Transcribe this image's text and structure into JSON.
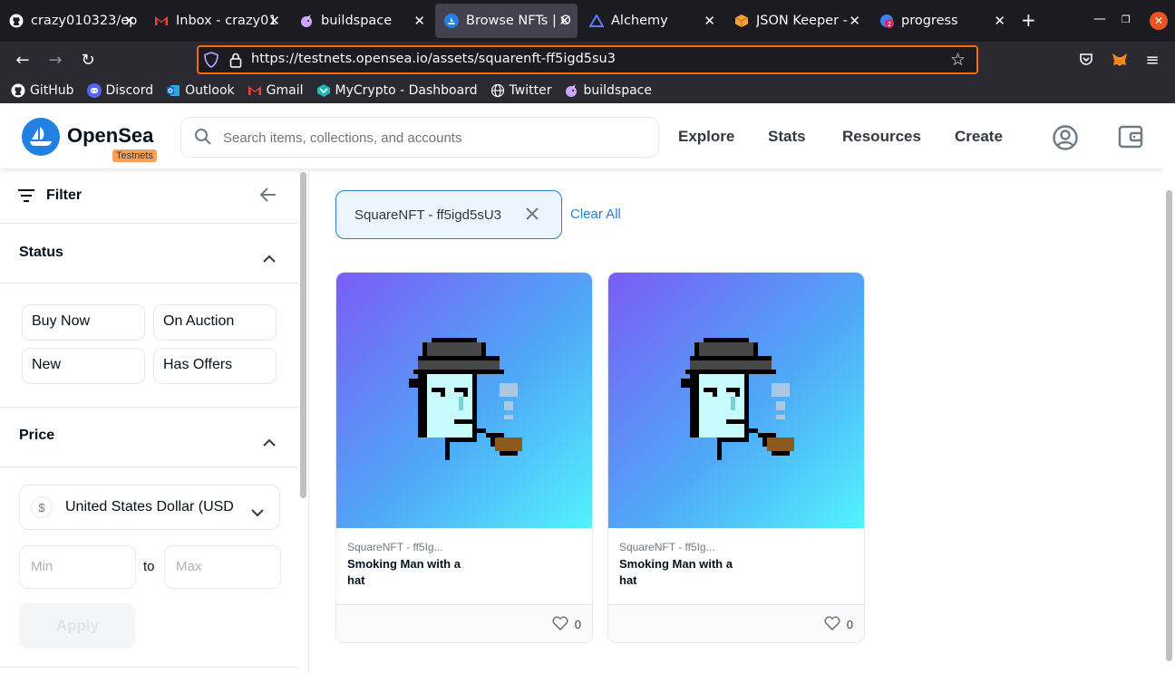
{
  "tabs": [
    {
      "title": "crazy010323/ep",
      "icon": "github-icon"
    },
    {
      "title": "Inbox - crazy01",
      "icon": "gmail-icon"
    },
    {
      "title": "buildspace",
      "icon": "unicorn-icon"
    },
    {
      "title": "Browse NFTs | O",
      "icon": "opensea-icon"
    },
    {
      "title": "Alchemy",
      "icon": "alchemy-icon"
    },
    {
      "title": "JSON Keeper - ",
      "icon": "box-icon"
    },
    {
      "title": "progress",
      "icon": "progress-icon"
    }
  ],
  "address_bar": {
    "url": "https://testnets.opensea.io/assets/squarenft-ff5igd5su3"
  },
  "bookmarks": [
    {
      "label": "GitHub",
      "icon": "github-icon"
    },
    {
      "label": "Discord",
      "icon": "discord-icon"
    },
    {
      "label": "Outlook",
      "icon": "outlook-icon"
    },
    {
      "label": "Gmail",
      "icon": "gmail-icon"
    },
    {
      "label": "MyCrypto - Dashboard",
      "icon": "mycrypto-icon"
    },
    {
      "label": "Twitter",
      "icon": "globe-icon"
    },
    {
      "label": "buildspace",
      "icon": "unicorn-icon"
    }
  ],
  "header": {
    "brand": "OpenSea",
    "badge": "Testnets",
    "search_placeholder": "Search items, collections, and accounts",
    "nav": [
      "Explore",
      "Stats",
      "Resources",
      "Create"
    ]
  },
  "sidebar": {
    "filter_title": "Filter",
    "status_title": "Status",
    "status_options": [
      "Buy Now",
      "On Auction",
      "New",
      "Has Offers"
    ],
    "price_title": "Price",
    "currency": "United States Dollar (USD",
    "min_placeholder": "Min",
    "to_label": "to",
    "max_placeholder": "Max",
    "apply_label": "Apply"
  },
  "active_filter": {
    "label": "SquareNFT - ff5igd5sU3",
    "clear_label": "Clear All"
  },
  "cards": [
    {
      "collection": "SquareNFT - ff5Ig...",
      "name": "Smoking Man with a hat",
      "likes": "0"
    },
    {
      "collection": "SquareNFT - ff5Ig...",
      "name": "Smoking Man with a hat",
      "likes": "0"
    }
  ],
  "colors": {
    "accent": "#2081e2",
    "testnets_badge": "#f6a156",
    "url_focus": "#f96a00"
  }
}
